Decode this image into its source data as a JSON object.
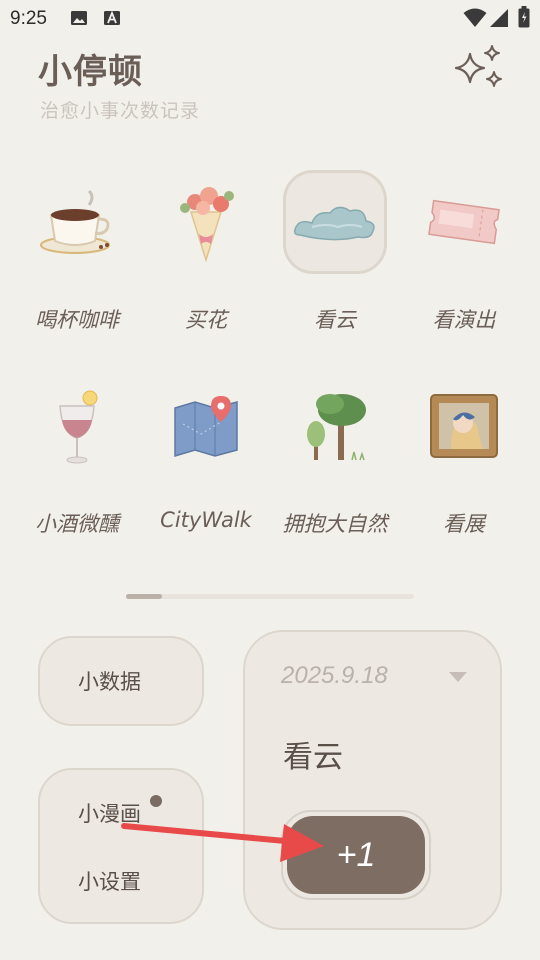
{
  "status_bar": {
    "time": "9:25"
  },
  "header": {
    "title": "小停顿",
    "subtitle": "治愈小事次数记录"
  },
  "activities": [
    {
      "label": "喝杯咖啡",
      "icon": "coffee-cup-icon"
    },
    {
      "label": "买花",
      "icon": "flower-bouquet-icon"
    },
    {
      "label": "看云",
      "icon": "cloud-icon",
      "selected": true
    },
    {
      "label": "看演出",
      "icon": "ticket-icon"
    },
    {
      "label": "小酒微醺",
      "icon": "cocktail-glass-icon"
    },
    {
      "label": "CityWalk",
      "icon": "map-pin-icon"
    },
    {
      "label": "拥抱大自然",
      "icon": "trees-icon"
    },
    {
      "label": "看展",
      "icon": "framed-painting-icon"
    }
  ],
  "cards": {
    "data_label": "小数据",
    "comic_label": "小漫画",
    "settings_label": "小设置"
  },
  "record": {
    "date": "2025.9.18",
    "activity": "看云",
    "increment_label": "+1"
  },
  "colors": {
    "background": "#f2f0eb",
    "accent_button": "#7d6d62",
    "annotation_arrow": "#e84a4a"
  }
}
